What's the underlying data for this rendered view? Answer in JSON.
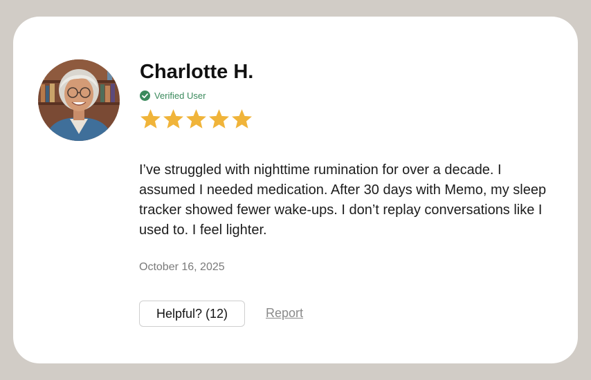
{
  "review": {
    "author_name": "Charlotte H.",
    "verified_label": "Verified User",
    "avatar_icon": "person-photo",
    "verified_icon": "check-circle-icon",
    "verified_color": "#3a8a5c",
    "rating": 5,
    "rating_max": 5,
    "star_color": "#f0b43a",
    "text": "I’ve struggled with nighttime rumination for over a decade. I assumed I needed medication. After 30 days with Memo, my sleep tracker showed fewer wake-ups. I don’t replay conversations like I used to. I feel lighter.",
    "date": "October 16, 2025",
    "helpful_label": "Helpful? (12)",
    "report_label": "Report"
  },
  "colors": {
    "background": "#d1ccc6",
    "card": "#ffffff"
  }
}
